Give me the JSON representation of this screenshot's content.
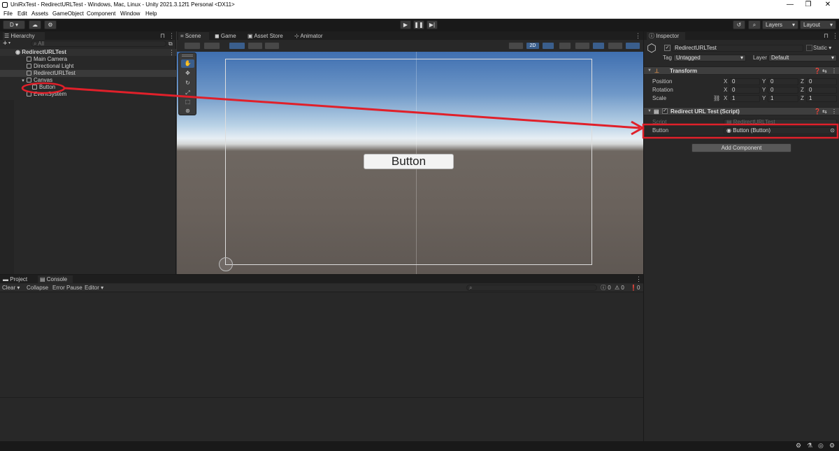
{
  "window": {
    "title": "UniRxTest - RedirectURLTest - Windows, Mac, Linux - Unity 2021.3.12f1 Personal <DX11>",
    "minimize": "—",
    "maximize": "❐",
    "close": "✕"
  },
  "menu": [
    "File",
    "Edit",
    "Assets",
    "GameObject",
    "Component",
    "Window",
    "Help"
  ],
  "toolbar": {
    "account": "D",
    "layers": "Layers",
    "layout": "Layout",
    "play": "▶",
    "pause": "❚❚",
    "step": "▶|",
    "history": "↺",
    "search": "⌕"
  },
  "hierarchy": {
    "tab": "Hierarchy",
    "search_placeholder": "All",
    "add": "+",
    "scene": "RedirectURLTest",
    "items": [
      "Main Camera",
      "Directional Light",
      "RedirectURLTest",
      "Canvas",
      "Button",
      "EventSystem"
    ]
  },
  "scene_tabs": [
    "Scene",
    "Game",
    "Asset Store",
    "Animator"
  ],
  "scene": {
    "mode_2d": "2D",
    "button_label": "Button"
  },
  "bottom": {
    "tabs": [
      "Project",
      "Console"
    ],
    "console_buttons": [
      "Clear",
      "Collapse",
      "Error Pause",
      "Editor"
    ],
    "counts": [
      "0",
      "0",
      "0"
    ]
  },
  "inspector": {
    "tab": "Inspector",
    "object_name": "RedirectURLTest",
    "static": "Static",
    "tag_label": "Tag",
    "tag": "Untagged",
    "layer_label": "Layer",
    "layer": "Default",
    "transform": {
      "header": "Transform",
      "position": {
        "label": "Position",
        "x": "0",
        "y": "0",
        "z": "0"
      },
      "rotation": {
        "label": "Rotation",
        "x": "0",
        "y": "0",
        "z": "0"
      },
      "scale": {
        "label": "Scale",
        "x": "1",
        "y": "1",
        "z": "1"
      }
    },
    "script_component": {
      "header": "Redirect URL Test (Script)",
      "script_label": "Script",
      "script_value": "RedirectURLTest",
      "button_label": "Button",
      "button_value": "Button (Button)"
    },
    "add_component": "Add Component"
  },
  "colors": {
    "annotation": "#e0202a",
    "accent": "#3a79bb",
    "panel": "#282828"
  }
}
